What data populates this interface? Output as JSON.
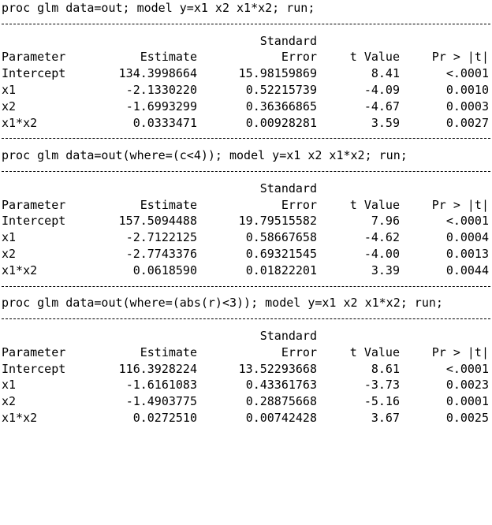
{
  "blocks": [
    {
      "command": "proc glm data=out; model y=x1 x2 x1*x2; run;",
      "header_top": "Standard",
      "headers": [
        "Parameter",
        "Estimate",
        "Error",
        "t Value",
        "Pr > |t|"
      ],
      "rows": [
        [
          "Intercept",
          "134.3998664",
          "15.98159869",
          "8.41",
          "<.0001"
        ],
        [
          "x1",
          "-2.1330220",
          "0.52215739",
          "-4.09",
          "0.0010"
        ],
        [
          "x2",
          "-1.6993299",
          "0.36366865",
          "-4.67",
          "0.0003"
        ],
        [
          "x1*x2",
          "0.0333471",
          "0.00928281",
          "3.59",
          "0.0027"
        ]
      ]
    },
    {
      "command": "proc glm data=out(where=(c<4)); model y=x1 x2 x1*x2; run;",
      "header_top": "Standard",
      "headers": [
        "Parameter",
        "Estimate",
        "Error",
        "t Value",
        "Pr > |t|"
      ],
      "rows": [
        [
          "Intercept",
          "157.5094488",
          "19.79515582",
          "7.96",
          "<.0001"
        ],
        [
          "x1",
          "-2.7122125",
          "0.58667658",
          "-4.62",
          "0.0004"
        ],
        [
          "x2",
          "-2.7743376",
          "0.69321545",
          "-4.00",
          "0.0013"
        ],
        [
          "x1*x2",
          "0.0618590",
          "0.01822201",
          "3.39",
          "0.0044"
        ]
      ]
    },
    {
      "command": "proc glm data=out(where=(abs(r)<3)); model y=x1 x2 x1*x2; run;",
      "header_top": "Standard",
      "headers": [
        "Parameter",
        "Estimate",
        "Error",
        "t Value",
        "Pr > |t|"
      ],
      "rows": [
        [
          "Intercept",
          "116.3928224",
          "13.52293668",
          "8.61",
          "<.0001"
        ],
        [
          "x1",
          "-1.6161083",
          "0.43361763",
          "-3.73",
          "0.0023"
        ],
        [
          "x2",
          "-1.4903775",
          "0.28875668",
          "-5.16",
          "0.0001"
        ],
        [
          "x1*x2",
          "0.0272510",
          "0.00742428",
          "3.67",
          "0.0025"
        ]
      ]
    }
  ]
}
